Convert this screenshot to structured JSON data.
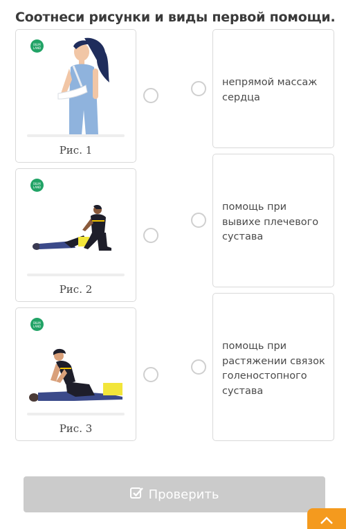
{
  "page": {
    "title": "Соотнеси рисунки и виды первой помощи."
  },
  "images": [
    {
      "caption": "Рис. 1",
      "badge": "BILIM LAND"
    },
    {
      "caption": "Рис. 2",
      "badge": "BILIM LAND"
    },
    {
      "caption": "Рис. 3",
      "badge": "BILIM LAND"
    }
  ],
  "answers": [
    {
      "text": "непрямой массаж сердца"
    },
    {
      "text": "помощь при вывихе плечевого сустава"
    },
    {
      "text": "помощь при растяжении связок голеностопного сустава"
    }
  ],
  "footer": {
    "check_label": "Проверить"
  },
  "colors": {
    "badge": "#21a366",
    "scroll_up": "#f49a1e",
    "check_button": "#cbcbcb",
    "figure_shirt": "#8fb3dd",
    "figure_hair": "#1f2d5c"
  },
  "icons": {
    "check": "check-square-icon",
    "scroll": "chevron-up-icon"
  }
}
